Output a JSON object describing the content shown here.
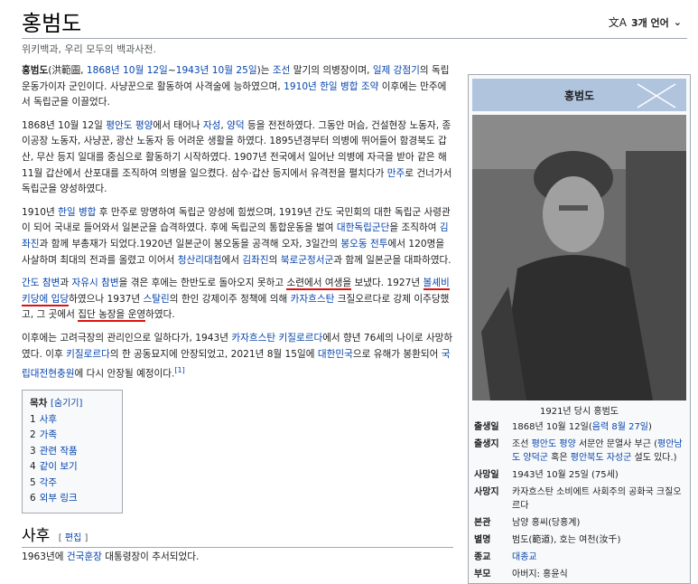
{
  "page": {
    "title": "홍범도",
    "lang_button": "3개 언어",
    "tagline": "위키백과, 우리 모두의 백과사전."
  },
  "paragraphs": [
    [
      {
        "t": "홍범도",
        "b": true
      },
      {
        "t": "(洪範圖, "
      },
      {
        "t": "1868년 10월 12일",
        "l": true
      },
      {
        "t": "~"
      },
      {
        "t": "1943년 10월 25일",
        "l": true
      },
      {
        "t": ")는 "
      },
      {
        "t": "조선",
        "l": true
      },
      {
        "t": " 말기의 의병장이며, "
      },
      {
        "t": "일제 강점기",
        "l": true
      },
      {
        "t": "의 독립운동가이자 군인이다. 사냥꾼으로 활동하여 사격술에 능하였으며, "
      },
      {
        "t": "1910년",
        "l": true
      },
      {
        "t": " "
      },
      {
        "t": "한일 병합 조약",
        "l": true
      },
      {
        "t": " 이후에는 만주에서 독립군을 이끌었다."
      }
    ],
    [
      {
        "t": "1868년 10월 12일 "
      },
      {
        "t": "평안도",
        "l": true
      },
      {
        "t": " "
      },
      {
        "t": "평양",
        "l": true
      },
      {
        "t": "에서 태어나 "
      },
      {
        "t": "자성",
        "l": true
      },
      {
        "t": ", "
      },
      {
        "t": "양덕",
        "l": true
      },
      {
        "t": " 등을 전전하였다. 그동안 머슴, 건설현장 노동자, 종이공장 노동자, 사냥꾼, 광산 노동자 등 어려운 생활을 하였다. 1895년경부터 의병에 뛰어들어 함경북도 갑산, 무산 등지 일대를 중심으로 활동하기 시작하였다. 1907년 전국에서 일어난 의병에 자극을 받아 같은 해 11월 갑산에서 산포대를 조직하여 의병을 일으켰다. 삼수·갑산 등지에서 유격전을 펼치다가 "
      },
      {
        "t": "만주",
        "l": true
      },
      {
        "t": "로 건너가서 독립군을 양성하였다."
      }
    ],
    [
      {
        "t": "1910년 "
      },
      {
        "t": "한일 병합",
        "l": true
      },
      {
        "t": " 후 만주로 망명하여 독립군 양성에 힘썼으며, 1919년 간도 국민회의 대한 독립군 사령관이 되어 국내로 들어와서 일본군을 습격하였다. 후에 독립군의 통합운동을 벌여 "
      },
      {
        "t": "대한독립군단",
        "l": true
      },
      {
        "t": "을 조직하여 "
      },
      {
        "t": "김좌진",
        "l": true
      },
      {
        "t": "과 함께 부총재가 되었다.1920년 일본군이 봉오동을 공격해 오자, 3일간의 "
      },
      {
        "t": "봉오동 전투",
        "l": true
      },
      {
        "t": "에서 120명을 사살하며 최대의 전과를 올렸고 이어서 "
      },
      {
        "t": "청산리대첩",
        "l": true
      },
      {
        "t": "에서 "
      },
      {
        "t": "김좌진",
        "l": true
      },
      {
        "t": "의 "
      },
      {
        "t": "북로군정서군",
        "l": true
      },
      {
        "t": "과 함께 일본군을 대파하였다."
      }
    ],
    [
      {
        "t": "간도 참변",
        "l": true
      },
      {
        "t": "과 "
      },
      {
        "t": "자유시 참변",
        "l": true
      },
      {
        "t": "을 겪은 후에는 한반도로 돌아오지 못하고 "
      },
      {
        "t": "소련에서 여생을",
        "u": true
      },
      {
        "t": " 보냈다. 1927년 "
      },
      {
        "t": "볼셰비키당에 입당",
        "u": true,
        "l": true
      },
      {
        "t": "하였으나 1937년 "
      },
      {
        "t": "스탈린",
        "l": true
      },
      {
        "t": "의 한인 강제이주 정책에 의해 "
      },
      {
        "t": "카자흐스탄",
        "l": true
      },
      {
        "t": " 크질오르다로 강제 이주당했고, 그 곳에서 "
      },
      {
        "t": "집단 농장을 운영",
        "u": true
      },
      {
        "t": "하였다."
      }
    ],
    [
      {
        "t": "이후에는 고려극장의 관리인으로 일하다가, 1943년 "
      },
      {
        "t": "카자흐스탄",
        "l": true
      },
      {
        "t": " "
      },
      {
        "t": "키질로르다",
        "l": true
      },
      {
        "t": "에서 향년 76세의 나이로 사망하였다. 이후 "
      },
      {
        "t": "키질로르다",
        "l": true
      },
      {
        "t": "의 한 공동묘지에 안장되었고, 2021년 8월 15일에 "
      },
      {
        "t": "대한민국",
        "l": true
      },
      {
        "t": "으로 유해가 봉환되어 "
      },
      {
        "t": "국립대전현충원",
        "l": true
      },
      {
        "t": "에 다시 안장될 예정이다."
      },
      {
        "t": "[1]",
        "l": true,
        "sup": true
      }
    ]
  ],
  "toc": {
    "title": "목차",
    "toggle": "[숨기기]",
    "items": [
      {
        "num": "1",
        "label": "사후"
      },
      {
        "num": "2",
        "label": "가족"
      },
      {
        "num": "3",
        "label": "관련 작품"
      },
      {
        "num": "4",
        "label": "같이 보기"
      },
      {
        "num": "5",
        "label": "각주"
      },
      {
        "num": "6",
        "label": "외부 링크"
      }
    ]
  },
  "section": {
    "heading": "사후",
    "edit": "[ 편집 ]",
    "text_parts": [
      {
        "t": "1963년에 "
      },
      {
        "t": "건국훈장",
        "l": true
      },
      {
        "t": " 대통령장이 추서되었다."
      }
    ]
  },
  "infobox": {
    "title": "홍범도",
    "caption": "1921년 당시 홍범도",
    "rows": [
      {
        "key": "출생일",
        "parts": [
          {
            "t": "1868년 10월 12일("
          },
          {
            "t": "음력 8월 27일",
            "l": true
          },
          {
            "t": ")"
          }
        ]
      },
      {
        "key": "출생지",
        "parts": [
          {
            "t": "조선 "
          },
          {
            "t": "평안도",
            "l": true
          },
          {
            "t": " "
          },
          {
            "t": "평양",
            "l": true
          },
          {
            "t": " 서문안 문열사 부근 ("
          },
          {
            "t": "평안남도 양덕군",
            "l": true
          },
          {
            "t": " 혹은 "
          },
          {
            "t": "평안북도 자성군",
            "l": true
          },
          {
            "t": " 설도 있다.)"
          }
        ]
      },
      {
        "key": "사망일",
        "parts": [
          {
            "t": "1943년 10월 25일 (75세)"
          }
        ]
      },
      {
        "key": "사망지",
        "parts": [
          {
            "t": "카자흐스탄 소비에트 사회주의 공화국 크질오르다"
          }
        ]
      },
      {
        "key": "본관",
        "parts": [
          {
            "t": "남양 홍씨(당홍계)"
          }
        ]
      },
      {
        "key": "별명",
        "parts": [
          {
            "t": "범도(範道), 호는 여천(汝千)"
          }
        ]
      },
      {
        "key": "종교",
        "parts": [
          {
            "t": "대종교",
            "l": true
          }
        ]
      },
      {
        "key": "부모",
        "parts": [
          {
            "t": "아버지: 홍윤식"
          }
        ]
      }
    ]
  },
  "colors": {
    "link": "#0645ad",
    "underline": "#e01010",
    "infobox_header": "#b0c4de"
  },
  "icons": {
    "lang": "translate-icon",
    "chevron": "chevron-down-icon"
  }
}
